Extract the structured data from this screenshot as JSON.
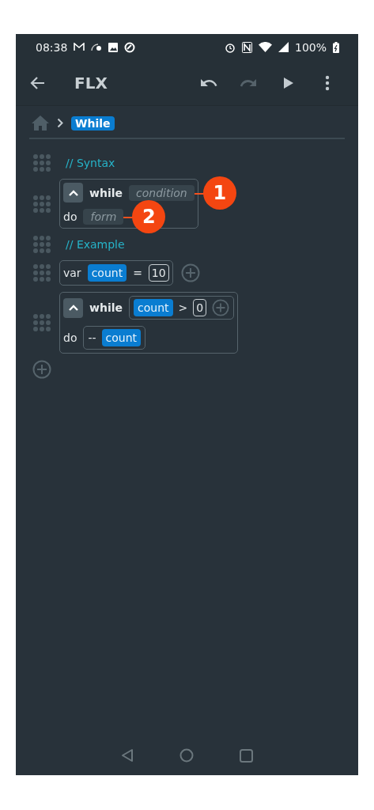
{
  "status_bar": {
    "time": "08:38",
    "battery": "100%"
  },
  "app_bar": {
    "title": "FLX",
    "actions": [
      {
        "kind": "undo",
        "disabled": false
      },
      {
        "kind": "redo",
        "disabled": true
      },
      {
        "kind": "play",
        "disabled": false
      },
      {
        "kind": "more",
        "disabled": false
      }
    ]
  },
  "breadcrumb": {
    "current": "While"
  },
  "blocks": [
    {
      "kind": "comment",
      "text": "// Syntax"
    },
    {
      "kind": "while",
      "keyword": "while",
      "do_keyword": "do",
      "condition": {
        "kind": "placeholder",
        "text": "condition",
        "callout": "1"
      },
      "body": {
        "kind": "placeholder",
        "text": "form",
        "callout": "2"
      }
    },
    {
      "kind": "comment",
      "text": "// Example"
    },
    {
      "kind": "var",
      "keyword": "var",
      "name": "count",
      "operator": "=",
      "value": "10",
      "addable": true
    },
    {
      "kind": "while",
      "keyword": "while",
      "do_keyword": "do",
      "condition": {
        "kind": "group",
        "addable": true,
        "tokens": [
          {
            "kind": "symbol",
            "text": "count"
          },
          {
            "kind": "op",
            "text": ">"
          },
          {
            "kind": "literal",
            "text": "0"
          }
        ]
      },
      "body": {
        "kind": "group",
        "addable": false,
        "tokens": [
          {
            "kind": "op",
            "text": "--"
          },
          {
            "kind": "symbol",
            "text": "count"
          }
        ]
      }
    }
  ]
}
